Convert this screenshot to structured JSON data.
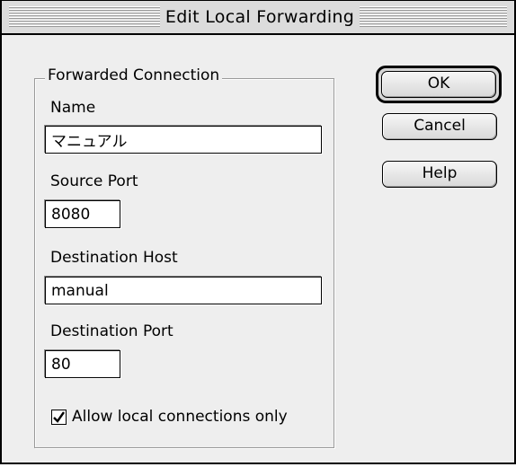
{
  "window": {
    "title": "Edit Local Forwarding"
  },
  "group": {
    "title": "Forwarded Connection"
  },
  "fields": {
    "name": {
      "label": "Name",
      "value": "マニュアル"
    },
    "source_port": {
      "label": "Source Port",
      "value": "8080"
    },
    "destination_host": {
      "label": "Destination Host",
      "value": "manual"
    },
    "destination_port": {
      "label": "Destination Port",
      "value": "80"
    }
  },
  "checkbox": {
    "label": "Allow local connections only",
    "checked": true
  },
  "buttons": {
    "ok": "OK",
    "cancel": "Cancel",
    "help": "Help"
  }
}
